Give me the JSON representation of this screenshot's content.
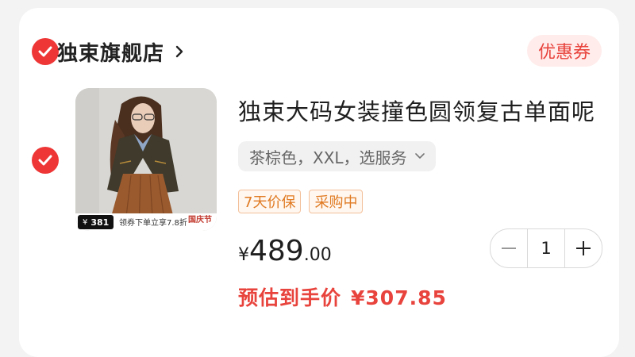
{
  "shop": {
    "name": "独束旗舰店",
    "coupon_label": "优惠券",
    "selected": true
  },
  "item": {
    "selected": true,
    "title": "独束大码女装撞色圆领复古单面呢",
    "variant": "茶棕色，XXL，选服务",
    "tags": [
      "7天价保",
      "采购中"
    ],
    "price": {
      "currency": "¥",
      "integer": "489",
      "decimal": ".00"
    },
    "quantity": "1",
    "estimate": {
      "label": "预估到手价",
      "amount": "¥307.85"
    },
    "thumbnail": {
      "price_chip": "381",
      "price_chip_currency": "¥",
      "promo_text": "领券下单立享7.8折",
      "event_text": "国庆节"
    }
  },
  "icons": {
    "check": "check-icon",
    "chevron_right": "chevron-right-icon",
    "chevron_down": "chevron-down-icon",
    "minus": "minus-icon",
    "plus": "plus-icon"
  },
  "colors": {
    "accent_red": "#ee3636",
    "price_red": "#e8433c",
    "tag_orange": "#e07a22",
    "coupon_bg": "#ffeceb"
  }
}
